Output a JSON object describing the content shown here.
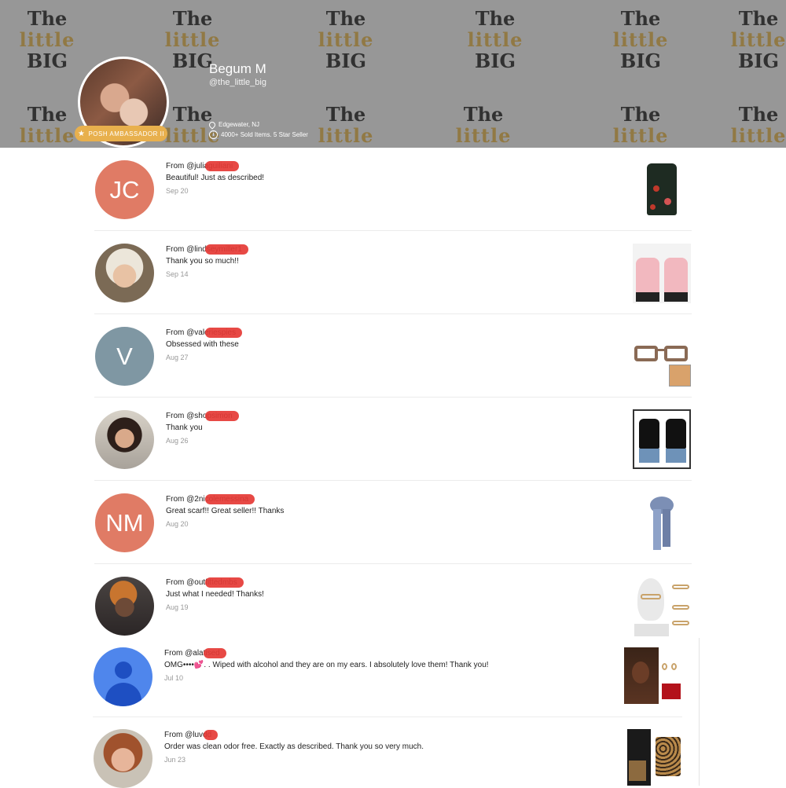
{
  "banner": {
    "tile_top": "The",
    "tile_mid": "little",
    "tile_bottom": "BIG"
  },
  "profile": {
    "name": "Begum M",
    "handle": "@the_little_big",
    "badge": "POSH AMBASSADOR II",
    "location": "Edgewater, NJ",
    "stats": "4000+ Sold Items. 5 Star Seller",
    "icons": {
      "badge": "star-icon",
      "location": "location-pin-icon",
      "stats": "info-icon"
    }
  },
  "reviews": [
    {
      "from": "From @",
      "handle": "juliaguiliani",
      "message": "Beautiful! Just as described!",
      "date": "Sep 20",
      "initials": "JC",
      "avatar_color": "#e07b65",
      "thumb": "black-floral-camisole"
    },
    {
      "from": "From @",
      "handle": "lindseymiller1",
      "message": "Thank you so much!!",
      "date": "Sep 14",
      "initials": "",
      "avatar_color": "",
      "thumb": "pink-long-sleeve-top"
    },
    {
      "from": "From @",
      "handle": "valeriespies",
      "message": "Obsessed with these",
      "date": "Aug 27",
      "initials": "V",
      "avatar_color": "#7f97a3",
      "thumb": "tortoise-eyeglasses"
    },
    {
      "from": "From @",
      "handle": "shopsimon",
      "message": "Thank you",
      "date": "Aug 26",
      "initials": "",
      "avatar_color": "",
      "thumb": "black-tank-top"
    },
    {
      "from": "From @",
      "handle": "2nicolemessina",
      "message": "Great scarf!! Great seller!! Thanks",
      "date": "Aug 20",
      "initials": "NM",
      "avatar_color": "#e07b65",
      "thumb": "blue-scarf"
    },
    {
      "from": "From @",
      "handle": "outfittedmbs",
      "message": "Just what I needed! Thanks!",
      "date": "Aug 19",
      "initials": "",
      "avatar_color": "",
      "thumb": "eyeglasses-mannequin"
    },
    {
      "from": "From @",
      "handle": "alatised",
      "message": "OMG••••💕. . Wiped with alcohol and they are on my ears. I absolutely love them! Thank you!",
      "date": "Jul 10",
      "initials": "",
      "avatar_color": "#4f86ec",
      "thumb": "earrings"
    },
    {
      "from": "From @",
      "handle": "luvdd",
      "message": "Order was clean odor free. Exactly as described. Thank you so very much.",
      "date": "Jun 23",
      "initials": "",
      "avatar_color": "",
      "thumb": "leopard-tote-bag"
    }
  ]
}
